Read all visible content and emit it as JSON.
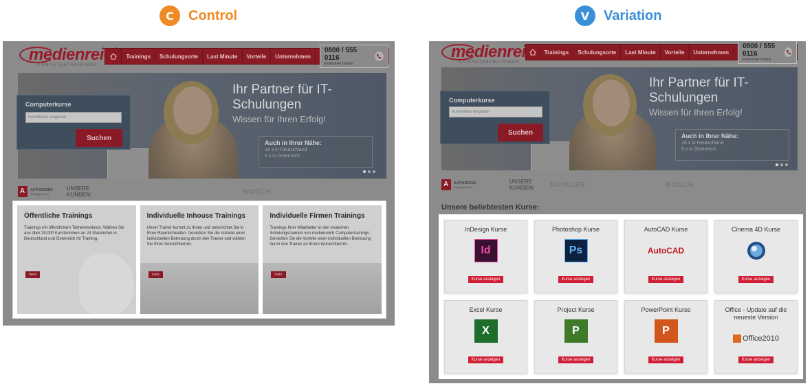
{
  "control": {
    "badge": "C",
    "label": "Control",
    "color": "#f08a24",
    "logo": "medienreich",
    "logo_sub": "COMPUTERTRAININGS",
    "nav": [
      "Trainings",
      "Schulungsorte",
      "Last Minute",
      "Vorteile",
      "Unternehmen"
    ],
    "phone": "0800 / 555 0116",
    "phone_sub": "kostenfreie Hotline",
    "search": {
      "title": "Computerkurse",
      "placeholder": "Kursthema eingeben",
      "button": "Suchen"
    },
    "hero": {
      "title_1": "Ihr Partner für IT-",
      "title_2": "Schulungen",
      "subtitle": "Wissen für Ihren Erfolg!"
    },
    "near": {
      "title": "Auch in Ihrer Nähe:",
      "line1": "18 x in Deutschland",
      "line2": "5 x in Österreich"
    },
    "adobe_auth": "AUTHORIZED",
    "adobe_sub": "Training Center",
    "kunden_1": "UNSERE",
    "kunden_2": "KUNDEN:",
    "clients": [
      "BOSCH"
    ],
    "cards": [
      {
        "title": "Öffentliche Trainings",
        "text": "Trainings mit öffentlichem Teilnehmerkreis. Wählen Sie aus über 29.000 Kursterminen an 24 Standorten in Deutschland und Österreich Ihr Training.",
        "button": "mehr"
      },
      {
        "title": "Individuelle Inhouse Trainings",
        "text": "Unser Trainer kommt zu Ihnen und unterrichtet Sie in Ihren Räumlichkeiten. Genießen Sie die Vorteile einer individuellen Betreuung durch den Trainer und wählen Sie Ihren Wunschtermin.",
        "button": "mehr"
      },
      {
        "title": "Individuelle Firmen Trainings",
        "text": "Trainings Ihrer Mitarbeiter in den modernen Schulungsräumen von medienreich Computertrainings. Genießen Sie die Vorteile einer individuellen Betreuung durch den Trainer an Ihrem Wunschtermin.",
        "button": "mehr"
      }
    ]
  },
  "variation": {
    "badge": "V",
    "label": "Variation",
    "color": "#3a8fd9",
    "logo": "medienreich",
    "logo_sub": "COMPUTERTRAININGS",
    "nav": [
      "Trainings",
      "Schulungsorte",
      "Last Minute",
      "Vorteile",
      "Unternehmen"
    ],
    "phone": "0800 / 555 0116",
    "phone_sub": "kostenfreie Hotline",
    "search": {
      "title": "Computerkurse",
      "placeholder": "Kursthema eingeben",
      "button": "Suchen"
    },
    "hero": {
      "title_1": "Ihr Partner für IT-",
      "title_2": "Schulungen",
      "subtitle": "Wissen für Ihren Erfolg!"
    },
    "near": {
      "title": "Auch in Ihrer Nähe:",
      "line1": "18 x in Deutschland",
      "line2": "5 x in Österreich"
    },
    "adobe_auth": "AUTHORIZED",
    "adobe_sub": "Training Center",
    "kunden_1": "UNSERE",
    "kunden_2": "KUNDEN:",
    "clients": [
      "DAIMLER",
      "BOSCH"
    ],
    "kurse_label": "Unsere beliebtesten Kurse:",
    "courses": [
      {
        "title": "InDesign Kurse",
        "icon": "Id",
        "icon_name": "indesign-icon",
        "bg": "#3a1030",
        "fg": "#e84fa8",
        "button": "Kurse anzeigen"
      },
      {
        "title": "Photoshop Kurse",
        "icon": "Ps",
        "icon_name": "photoshop-icon",
        "bg": "#0e2140",
        "fg": "#5cb3f2",
        "button": "Kurse anzeigen"
      },
      {
        "title": "AutoCAD Kurse",
        "icon": "AutoCAD",
        "icon_name": "autocad-icon",
        "bg": "transparent",
        "fg": "#c0151e",
        "button": "Kurse anzeigen"
      },
      {
        "title": "Cinema 4D Kurse",
        "icon": "◉",
        "icon_name": "cinema4d-icon",
        "bg": "transparent",
        "fg": "#2a6fb0",
        "button": "Kurse anzeigen"
      },
      {
        "title": "Excel Kurse",
        "icon": "X",
        "icon_name": "excel-icon",
        "bg": "#1f6d2c",
        "fg": "#ffffff",
        "button": "Kurse anzeigen"
      },
      {
        "title": "Project Kurse",
        "icon": "P",
        "icon_name": "project-icon",
        "bg": "#3e7a2a",
        "fg": "#ffffff",
        "button": "Kurse anzeigen"
      },
      {
        "title": "PowerPoint Kurse",
        "icon": "P",
        "icon_name": "powerpoint-icon",
        "bg": "#d0561b",
        "fg": "#ffffff",
        "button": "Kurse anzeigen"
      },
      {
        "title": "Office - Update auf die neueste Version",
        "icon": "Office2010",
        "icon_name": "office-icon",
        "bg": "transparent",
        "fg": "#333333",
        "button": "Kurse anzeigen"
      }
    ]
  }
}
